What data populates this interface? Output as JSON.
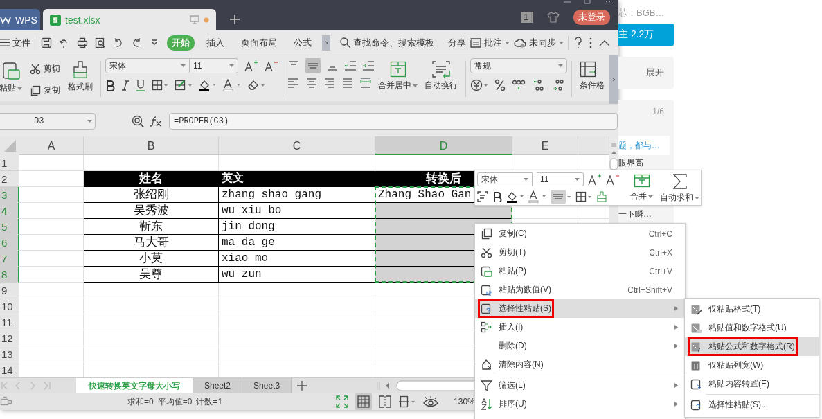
{
  "window": {
    "tabs": [
      {
        "label": "WPS",
        "kind": "home",
        "selected": false
      },
      {
        "label": "test.xlsx",
        "kind": "document",
        "selected": true
      }
    ],
    "counter": "1",
    "login": "未登录"
  },
  "menu_bar": {
    "file": "文件",
    "tabs": [
      {
        "label": "开始",
        "selected": true
      },
      {
        "label": "插入",
        "selected": false
      },
      {
        "label": "页面布局",
        "selected": false
      },
      {
        "label": "公式",
        "selected": false
      }
    ],
    "search": "查找命令、搜索模板",
    "share": "分享",
    "comment": "批注",
    "sync": "未同步"
  },
  "ribbon": {
    "paste": "粘贴",
    "cut": "剪切",
    "copy": "复制",
    "format_painter": "格式刷",
    "font": "宋体",
    "font_size": "11",
    "merge": "合并居中",
    "wrap": "自动换行",
    "number_format": "常规",
    "conditional_format": "条件格"
  },
  "formula_bar": {
    "cell": "D3",
    "formula": "=PROPER(C3)"
  },
  "sheet": {
    "columns": [
      {
        "label": "A",
        "selected": false
      },
      {
        "label": "B",
        "selected": false
      },
      {
        "label": "C",
        "selected": false
      },
      {
        "label": "D",
        "selected": true
      },
      {
        "label": "E",
        "selected": false
      }
    ],
    "rows": [
      {
        "label": "1",
        "selected": false,
        "kind": "blank"
      },
      {
        "label": "2",
        "selected": false,
        "kind": "header",
        "cells": {
          "B": "姓名",
          "C": "英文",
          "D": "转换后"
        }
      },
      {
        "label": "3",
        "selected": true,
        "kind": "data",
        "cells": {
          "B": "张绍刚",
          "C": "zhang shao gang",
          "D": "Zhang Shao Gan"
        }
      },
      {
        "label": "4",
        "selected": true,
        "kind": "data",
        "cells": {
          "B": "吴秀波",
          "C": "wu xiu bo"
        }
      },
      {
        "label": "5",
        "selected": true,
        "kind": "data",
        "cells": {
          "B": "靳东",
          "C": "jin dong"
        }
      },
      {
        "label": "6",
        "selected": true,
        "kind": "data",
        "cells": {
          "B": "马大哥",
          "C": "ma da ge"
        }
      },
      {
        "label": "7",
        "selected": true,
        "kind": "data",
        "cells": {
          "B": "小莫",
          "C": "xiao mo"
        }
      },
      {
        "label": "8",
        "selected": true,
        "kind": "data",
        "cells": {
          "B": "吴尊",
          "C": "wu zun"
        }
      },
      {
        "label": "9",
        "selected": false,
        "kind": "blank"
      },
      {
        "label": "10",
        "selected": false,
        "kind": "blank"
      },
      {
        "label": "11",
        "selected": false,
        "kind": "blank"
      },
      {
        "label": "12",
        "selected": false,
        "kind": "blank"
      },
      {
        "label": "13",
        "selected": false,
        "kind": "blank"
      },
      {
        "label": "14",
        "selected": false,
        "kind": "blank"
      }
    ]
  },
  "sheet_tabs": [
    {
      "label": "快速转换英文字母大小写",
      "selected": true
    },
    {
      "label": "Sheet2",
      "selected": false
    },
    {
      "label": "Sheet3",
      "selected": false
    }
  ],
  "status_bar": {
    "sum": "求和=0",
    "average": "平均值=0",
    "count": "计数=1",
    "zoom": "130%"
  },
  "mini_toolbar": {
    "font": "宋体",
    "font_size": "11",
    "merge": "合并",
    "autosum": "自动求和"
  },
  "context_menu": {
    "groups": [
      [
        {
          "label": "复制(C)",
          "shortcut": "Ctrl+C",
          "kind": "copy",
          "submenu": false,
          "highlighted": false,
          "annotated": false
        },
        {
          "label": "剪切(T)",
          "shortcut": "Ctrl+X",
          "kind": "cut",
          "submenu": false,
          "highlighted": false,
          "annotated": false
        },
        {
          "label": "粘贴(P)",
          "shortcut": "Ctrl+V",
          "kind": "paste",
          "submenu": false,
          "highlighted": false,
          "annotated": false
        },
        {
          "label": "粘贴为数值(V)",
          "shortcut": "Ctrl+Shift+V",
          "kind": "paste-values",
          "submenu": false,
          "highlighted": false,
          "annotated": false
        },
        {
          "label": "选择性粘贴(S)",
          "kind": "paste-special",
          "submenu": true,
          "highlighted": true,
          "annotated": true
        },
        {
          "label": "插入(I)",
          "kind": "insert",
          "submenu": true,
          "highlighted": false,
          "annotated": false
        },
        {
          "label": "删除(D)",
          "kind": "plain",
          "submenu": true,
          "highlighted": false,
          "annotated": false
        },
        {
          "label": "清除内容(N)",
          "kind": "clear",
          "submenu": false,
          "highlighted": false,
          "annotated": false
        }
      ],
      [
        {
          "label": "筛选(L)",
          "kind": "filter",
          "submenu": true,
          "highlighted": false,
          "annotated": false
        },
        {
          "label": "排序(U)",
          "kind": "sort",
          "submenu": true,
          "highlighted": false,
          "annotated": false
        }
      ]
    ]
  },
  "submenu": {
    "groups": [
      [
        {
          "label": "仅粘贴格式(T)",
          "kind": "format",
          "highlighted": false,
          "annotated": false
        },
        {
          "label": "粘贴值和数字格式(U)",
          "kind": "values-number",
          "highlighted": false,
          "annotated": false
        },
        {
          "label": "粘贴公式和数字格式(R)",
          "kind": "formula-number",
          "highlighted": true,
          "annotated": true
        },
        {
          "label": "仅粘贴列宽(W)",
          "kind": "column-width",
          "highlighted": false,
          "annotated": false
        },
        {
          "label": "粘贴内容转置(E)",
          "kind": "transpose",
          "highlighted": false,
          "annotated": false
        }
      ],
      [
        {
          "label": "选择性粘贴(S)...",
          "kind": "paste-special",
          "highlighted": false,
          "annotated": false
        }
      ]
    ]
  },
  "web_page": {
    "author": "芯：BGB…",
    "follow": "主 2.2万",
    "expand": "展开",
    "pager": "1/6",
    "link": "题，都与…",
    "titles": [
      "眼界高",
      "一下瞬…"
    ]
  }
}
